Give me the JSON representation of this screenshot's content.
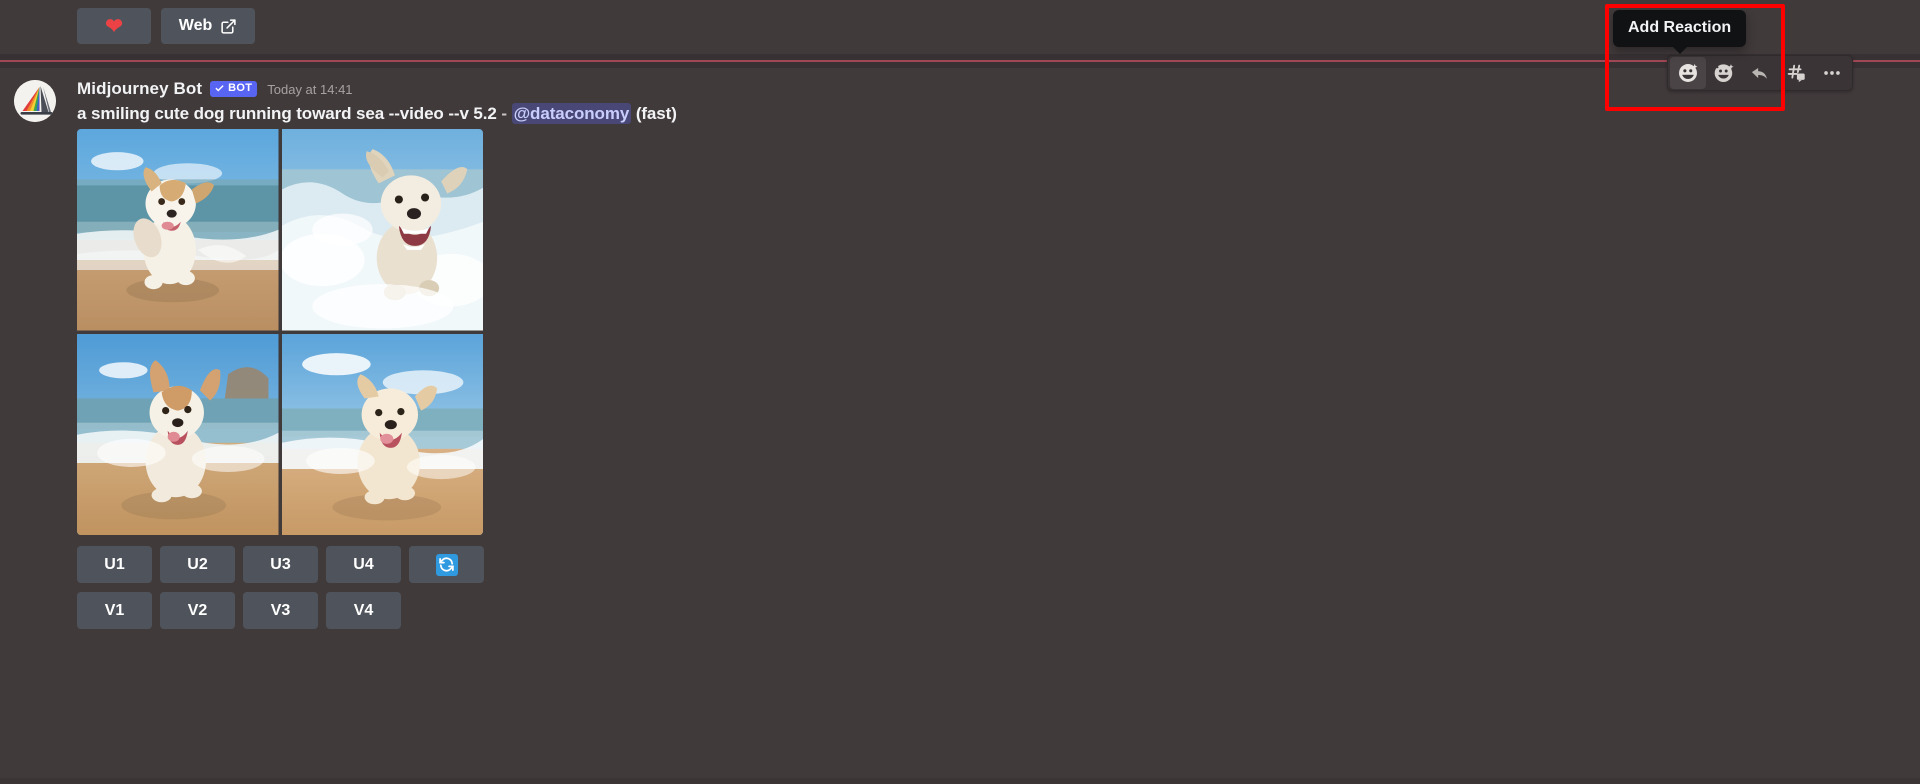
{
  "window": {
    "app": "Discord",
    "background_color": "#413a3b"
  },
  "top_bar": {
    "buttons": [
      {
        "name": "like-button",
        "icon": "heart-icon",
        "label": ""
      },
      {
        "name": "web-button",
        "icon": "external-link-icon",
        "label": "Web"
      }
    ]
  },
  "divider": {
    "color": "#b14b5a"
  },
  "message": {
    "avatar_icon": "midjourney-sailboat-avatar",
    "author": "Midjourney Bot",
    "bot_tag": "BOT",
    "bot_tag_color": "#5865f2",
    "timestamp": "Today at 14:41",
    "prompt": {
      "text": "a smiling cute dog running toward sea --video --v 5.2",
      "separator": "-",
      "mention": "@dataconomy",
      "speed": "(fast)"
    },
    "image_grid": {
      "alt": "four generated images of a smiling dog running toward the sea",
      "cells": [
        {
          "name": "image-quadrant-1",
          "description": "jack russell style dog running on wet sand with sea behind"
        },
        {
          "name": "image-quadrant-2",
          "description": "scruffy dog splashing through breaking waves"
        },
        {
          "name": "image-quadrant-3",
          "description": "corgi-like dog running through surf on beach"
        },
        {
          "name": "image-quadrant-4",
          "description": "golden retriever puppy running on shoreline"
        }
      ]
    },
    "upscale_buttons": [
      "U1",
      "U2",
      "U3",
      "U4"
    ],
    "reroll_button": {
      "name": "reroll-button",
      "icon": "refresh-icon",
      "color": "#2f9ae0"
    },
    "variation_buttons": [
      "V1",
      "V2",
      "V3",
      "V4"
    ]
  },
  "hover_toolbar": {
    "buttons": [
      {
        "name": "add-reaction-button",
        "icon": "add-reaction-icon",
        "active": true
      },
      {
        "name": "super-reaction-button",
        "icon": "super-reaction-icon",
        "active": false
      },
      {
        "name": "reply-button",
        "icon": "reply-arrow-icon",
        "active": false
      },
      {
        "name": "create-thread-button",
        "icon": "thread-hash-icon",
        "active": false
      },
      {
        "name": "more-actions-button",
        "icon": "more-horizontal-icon",
        "active": false
      }
    ]
  },
  "tooltip": {
    "text": "Add Reaction"
  },
  "annotation": {
    "highlight_color": "#ff0000"
  }
}
